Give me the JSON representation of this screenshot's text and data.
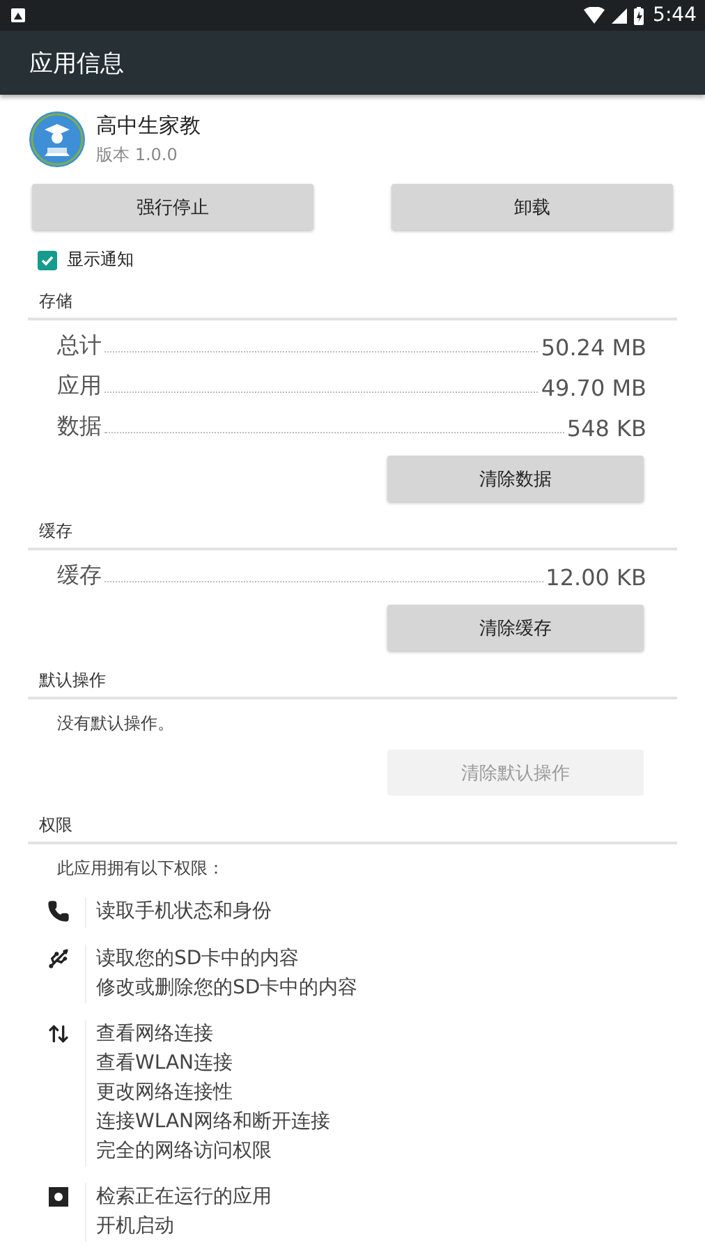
{
  "status_bar": {
    "time": "5:44"
  },
  "app_bar": {
    "title": "应用信息"
  },
  "app": {
    "name": "高中生家教",
    "version": "版本 1.0.0"
  },
  "actions": [
    {
      "label": "强行停止",
      "disabled": false
    },
    {
      "label": "卸载",
      "disabled": false
    }
  ],
  "notifications": {
    "label": "显示通知",
    "checked": true
  },
  "sections": [
    {
      "title": "存储",
      "rows": [
        {
          "label": "总计",
          "value": "50.24 MB"
        },
        {
          "label": "应用",
          "value": "49.70 MB"
        },
        {
          "label": "数据",
          "value": "548 KB"
        }
      ],
      "button": {
        "label": "清除数据",
        "disabled": false
      }
    },
    {
      "title": "缓存",
      "rows": [
        {
          "label": "缓存",
          "value": "12.00 KB"
        }
      ],
      "button": {
        "label": "清除缓存",
        "disabled": false
      }
    },
    {
      "title": "默认操作",
      "note": "没有默认操作。",
      "button": {
        "label": "清除默认操作",
        "disabled": true
      }
    },
    {
      "title": "权限",
      "note": "此应用拥有以下权限："
    }
  ],
  "permissions": [
    {
      "kind": "phone",
      "items": [
        "读取手机状态和身份"
      ]
    },
    {
      "kind": "storage",
      "items": [
        "读取您的SD卡中的内容",
        "修改或删除您的SD卡中的内容"
      ]
    },
    {
      "kind": "network",
      "items": [
        "查看网络连接",
        "查看WLAN连接",
        "更改网络连接性",
        "连接WLAN网络和断开连接",
        "完全的网络访问权限"
      ]
    },
    {
      "kind": "system",
      "items": [
        "检索正在运行的应用",
        "开机启动"
      ]
    }
  ]
}
